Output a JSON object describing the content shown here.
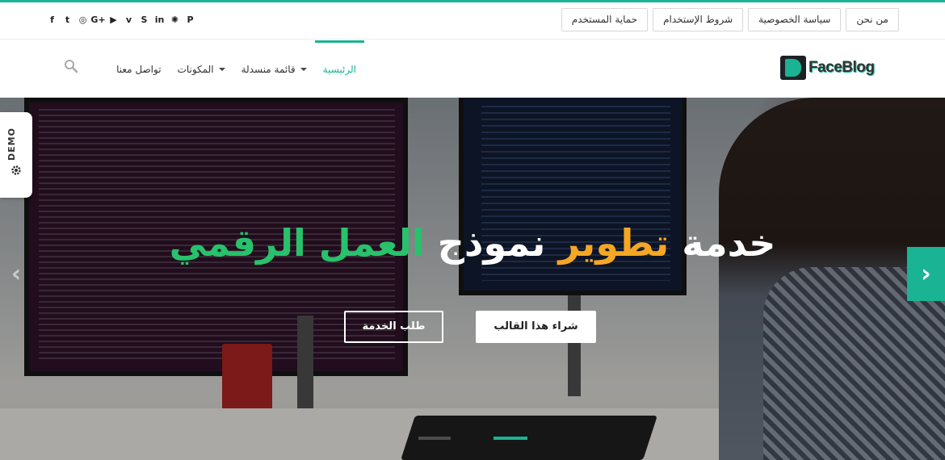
{
  "social": {
    "icons": [
      {
        "name": "facebook-icon",
        "glyph": "f"
      },
      {
        "name": "twitter-icon",
        "glyph": "t"
      },
      {
        "name": "instagram-icon",
        "glyph": "◎"
      },
      {
        "name": "google-plus-icon",
        "glyph": "G+"
      },
      {
        "name": "youtube-icon",
        "glyph": "▶"
      },
      {
        "name": "vimeo-icon",
        "glyph": "v"
      },
      {
        "name": "skype-icon",
        "glyph": "S"
      },
      {
        "name": "linkedin-icon",
        "glyph": "in"
      },
      {
        "name": "dribbble-icon",
        "glyph": "✺"
      },
      {
        "name": "pinterest-icon",
        "glyph": "P"
      }
    ]
  },
  "toplinks": {
    "about": "من نحن",
    "privacy": "سياسة الخصوصية",
    "terms": "شروط الإستخدام",
    "user_protection": "حماية المستخدم"
  },
  "logo": {
    "text": "FaceBlog"
  },
  "nav": {
    "home": "الرئيسية",
    "dropdown_menu": "قائمة منسدلة",
    "components": "المكونات",
    "contact": "تواصل معنا"
  },
  "hero": {
    "title_white_1": "خدمة ",
    "title_orange": "تطوير",
    "title_white_2": " نموذج ",
    "title_green": "العمل الرقمي",
    "buy_button": "شراء هذا القالب",
    "request_button": "طلب الخدمة"
  },
  "slider": {
    "slides": 2,
    "active_index": 1
  },
  "demo": {
    "label": "DEMO"
  },
  "colors": {
    "accent": "#1ab394",
    "orange": "#f5a623",
    "green": "#27c26b"
  }
}
